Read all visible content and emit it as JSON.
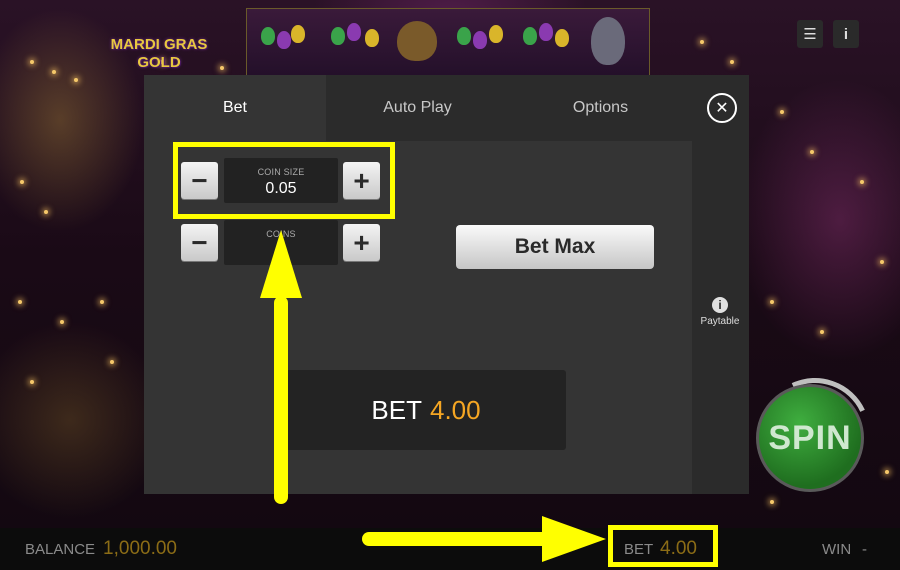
{
  "game": {
    "logo_text": "MARDI GRAS GOLD"
  },
  "top_controls": {
    "menu_icon": "hamburger-icon",
    "info_icon": "info-icon"
  },
  "modal": {
    "tabs": [
      {
        "label": "Bet",
        "active": true
      },
      {
        "label": "Auto Play",
        "active": false
      },
      {
        "label": "Options",
        "active": false
      }
    ],
    "close_icon": "close-icon",
    "coin_size": {
      "label": "COIN SIZE",
      "value": "0.05"
    },
    "coins": {
      "label": "COINS",
      "value": ""
    },
    "bet_max_label": "Bet Max",
    "bet_display": {
      "label": "BET",
      "amount": "4.00"
    },
    "paytable_label": "Paytable"
  },
  "spin_label": "SPIN",
  "bottom_bar": {
    "balance_label": "BALANCE",
    "balance_value": "1,000.00",
    "bet_label": "BET",
    "bet_value": "4.00",
    "win_label": "WIN",
    "win_value": "-"
  },
  "colors": {
    "highlight": "#ffff00",
    "amount": "#f5a623",
    "spin_green": "#2e8b2e"
  }
}
